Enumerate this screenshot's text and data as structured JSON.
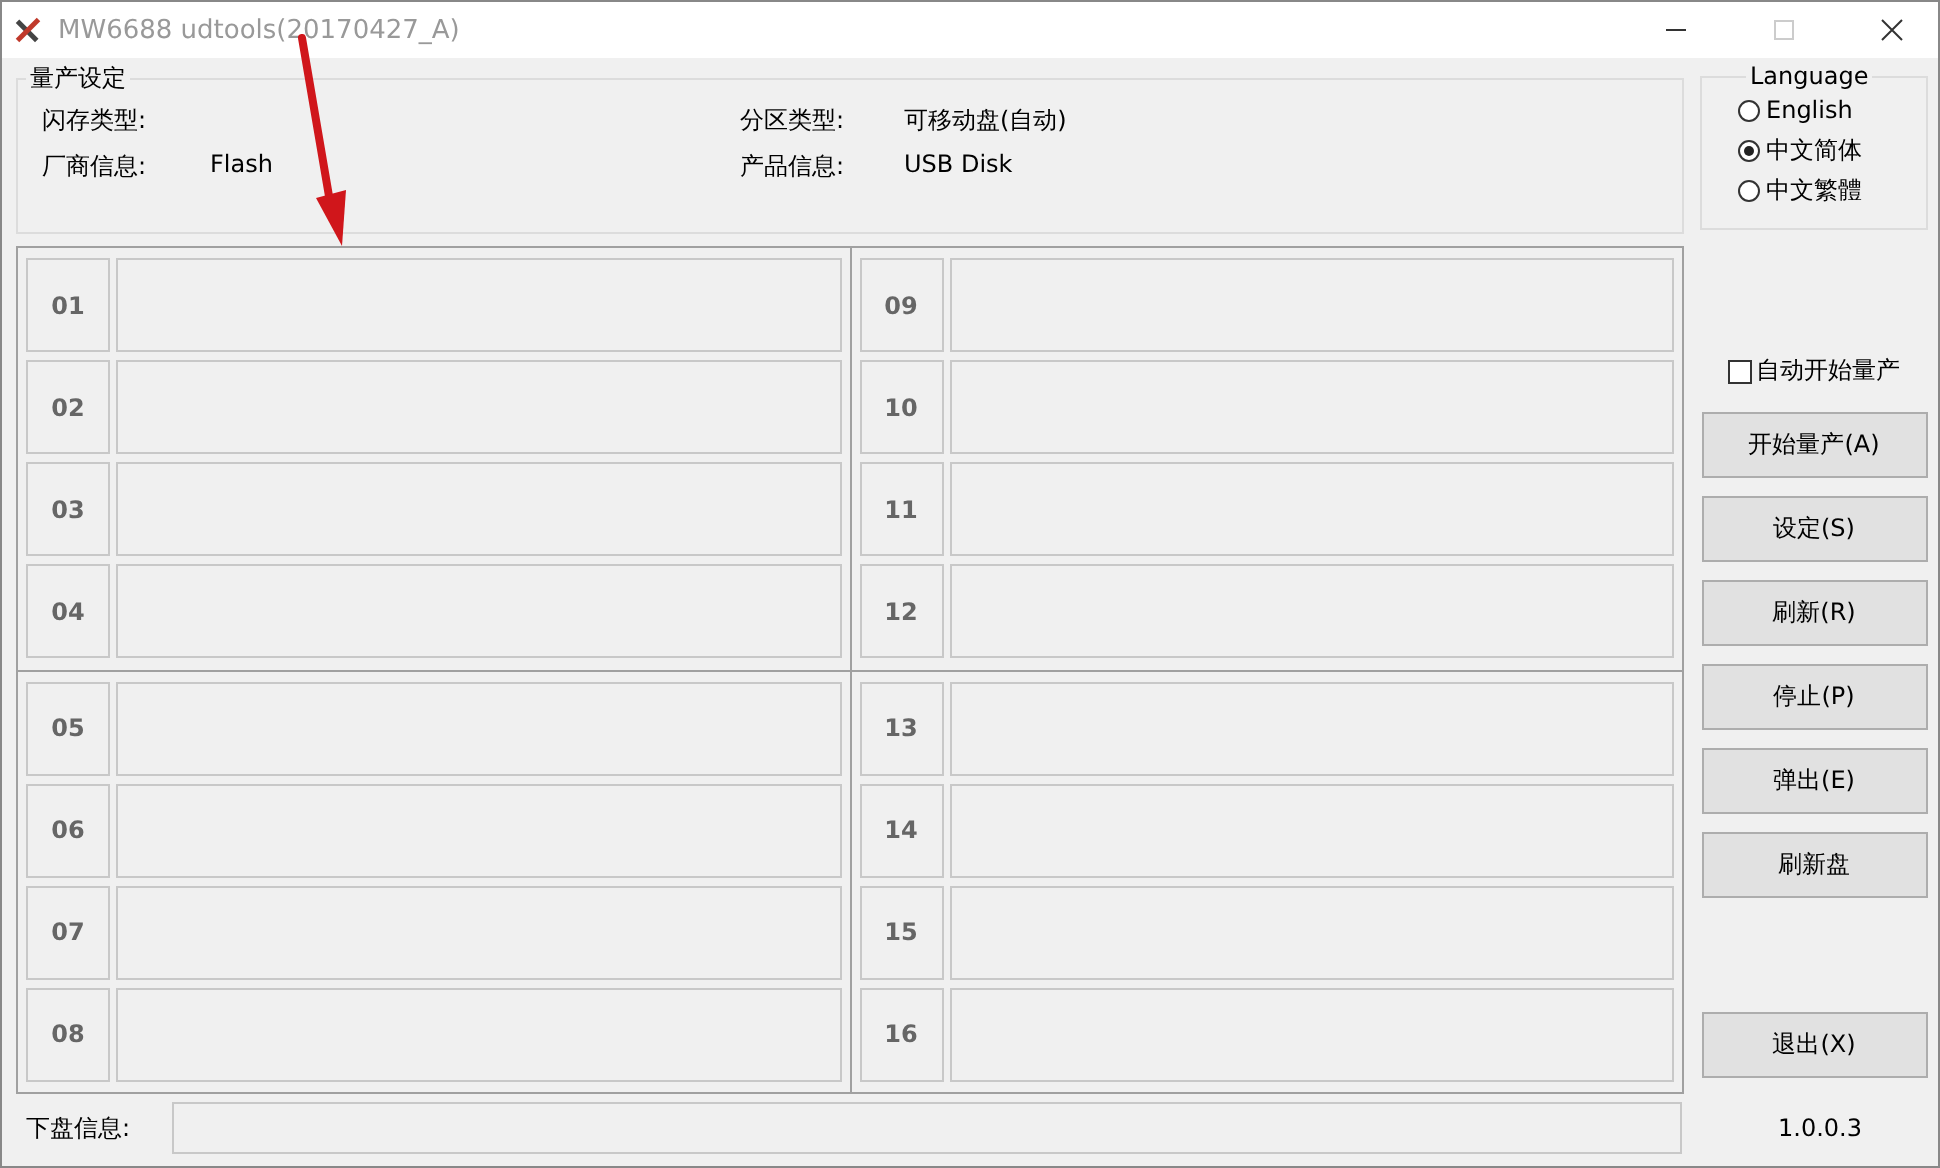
{
  "window": {
    "title": "MW6688 udtools(20170427_A)"
  },
  "settings": {
    "title": "量产设定",
    "fields": [
      {
        "label": "闪存类型:"
      },
      {
        "label": "分区类型:",
        "value": "可移动盘(自动)"
      },
      {
        "label": "厂商信息:",
        "value": "Flash"
      },
      {
        "label": "产品信息:",
        "value": "USB Disk"
      }
    ]
  },
  "language": {
    "title": "Language",
    "options": [
      {
        "label": "English",
        "selected": false
      },
      {
        "label": "中文简体",
        "selected": true
      },
      {
        "label": "中文繁體",
        "selected": false
      }
    ]
  },
  "ports": [
    "01",
    "02",
    "03",
    "04",
    "05",
    "06",
    "07",
    "08",
    "09",
    "10",
    "11",
    "12",
    "13",
    "14",
    "15",
    "16"
  ],
  "auto_start": {
    "label": "自动开始量产",
    "checked": false
  },
  "buttons": [
    {
      "label": "开始量产(A)"
    },
    {
      "label": "设定(S)"
    },
    {
      "label": "刷新(R)"
    },
    {
      "label": "停止(P)"
    },
    {
      "label": "弹出(E)"
    },
    {
      "label": "刷新盘"
    },
    {
      "label": "退出(X)"
    }
  ],
  "status": {
    "label": "下盘信息:",
    "version": "1.0.0.3"
  }
}
